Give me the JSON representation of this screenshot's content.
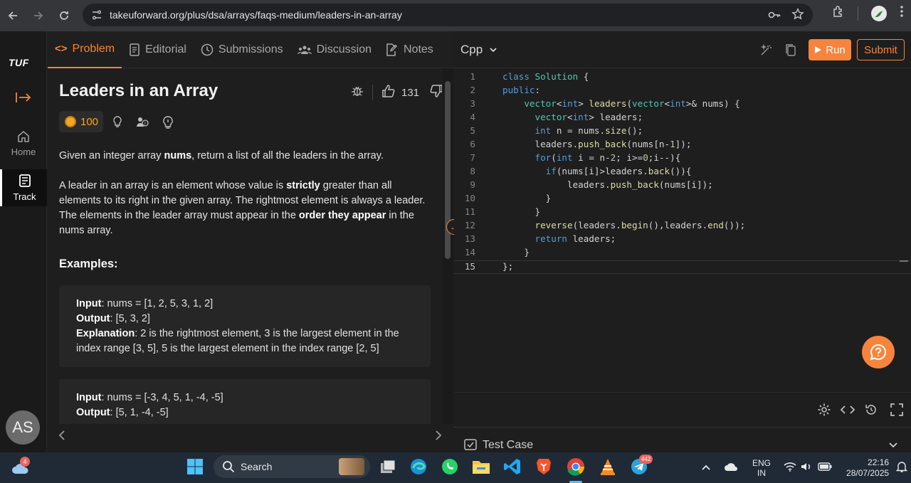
{
  "browser": {
    "url": "takeuforward.org/plus/dsa/arrays/faqs-medium/leaders-in-an-array"
  },
  "rail": {
    "logo": "TUF",
    "home_label": "Home",
    "track_label": "Track",
    "avatar_initials": "AS"
  },
  "tabs": {
    "problem": "Problem",
    "editorial": "Editorial",
    "submissions": "Submissions",
    "discussion": "Discussion",
    "notes": "Notes"
  },
  "problem": {
    "title": "Leaders in an Array",
    "likes": "131",
    "coins": "100",
    "p1_a": "Given an integer array ",
    "p1_b": "nums",
    "p1_c": ", return a list of all the leaders in the array.",
    "p2_a": "A leader in an array is an element whose value is ",
    "p2_b": "strictly",
    "p2_c": " greater than all elements to its right in the given array. The rightmost element is always a leader. The elements in the leader array must appear in the ",
    "p2_d": "order they appear",
    "p2_e": " in the nums array.",
    "examples_heading": "Examples:",
    "examples": [
      {
        "input_label": "Input",
        "input": ": nums = [1, 2, 5, 3, 1, 2]",
        "output_label": "Output",
        "output": ": [5, 3, 2]",
        "explanation_label": "Explanation",
        "explanation": ": 2 is the rightmost element, 3 is the largest element in the index range [3, 5], 5 is the largest element in the index range [2, 5]"
      },
      {
        "input_label": "Input",
        "input": ": nums = [-3, 4, 5, 1, -4, -5]",
        "output_label": "Output",
        "output": ": [5, 1, -4, -5]"
      }
    ]
  },
  "editor": {
    "language": "Cpp",
    "run_label": "Run",
    "submit_label": "Submit",
    "lines": [
      "class Solution {",
      "public:",
      "    vector<int> leaders(vector<int>& nums) {",
      "      vector<int> leaders;",
      "      int n = nums.size();",
      "      leaders.push_back(nums[n-1]);",
      "      for(int i = n-2; i>=0;i--){",
      "        if(nums[i]>leaders.back()){",
      "            leaders.push_back(nums[i]);",
      "        }",
      "      }",
      "      reverse(leaders.begin(),leaders.end());",
      "      return leaders;",
      "    }",
      "};"
    ],
    "line_numbers": [
      "1",
      "2",
      "3",
      "4",
      "5",
      "6",
      "7",
      "8",
      "9",
      "10",
      "11",
      "12",
      "13",
      "14",
      "15"
    ],
    "test_case_label": "Test Case"
  },
  "taskbar": {
    "weather_badge": "4",
    "search_label": "Search",
    "telegram_badge": "442",
    "lang_line1": "ENG",
    "lang_line2": "IN",
    "time": "22:16",
    "date": "28/07/2025"
  },
  "colors": {
    "accent": "#f7843c",
    "code_keyword": "#569cd6",
    "code_type": "#4ec9b0",
    "code_function": "#dcdcaa"
  }
}
